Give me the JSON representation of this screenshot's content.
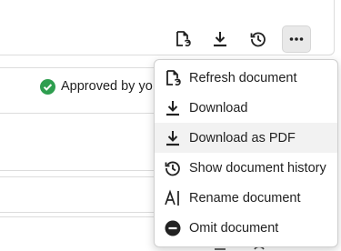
{
  "toolbar": {
    "refresh_icon": "refresh-document-icon",
    "download_icon": "download-icon",
    "history_icon": "history-icon",
    "more_icon": "more-horizontal-icon"
  },
  "status": {
    "approved_label": "Approved by yo",
    "approved_color": "#2e9e4f"
  },
  "menu": {
    "items": [
      {
        "label": "Refresh document",
        "icon": "refresh-document-icon"
      },
      {
        "label": "Download",
        "icon": "download-icon"
      },
      {
        "label": "Download as PDF",
        "icon": "download-icon"
      },
      {
        "label": "Show document history",
        "icon": "history-icon"
      },
      {
        "label": "Rename document",
        "icon": "rename-icon"
      },
      {
        "label": "Omit document",
        "icon": "omit-icon"
      }
    ]
  }
}
